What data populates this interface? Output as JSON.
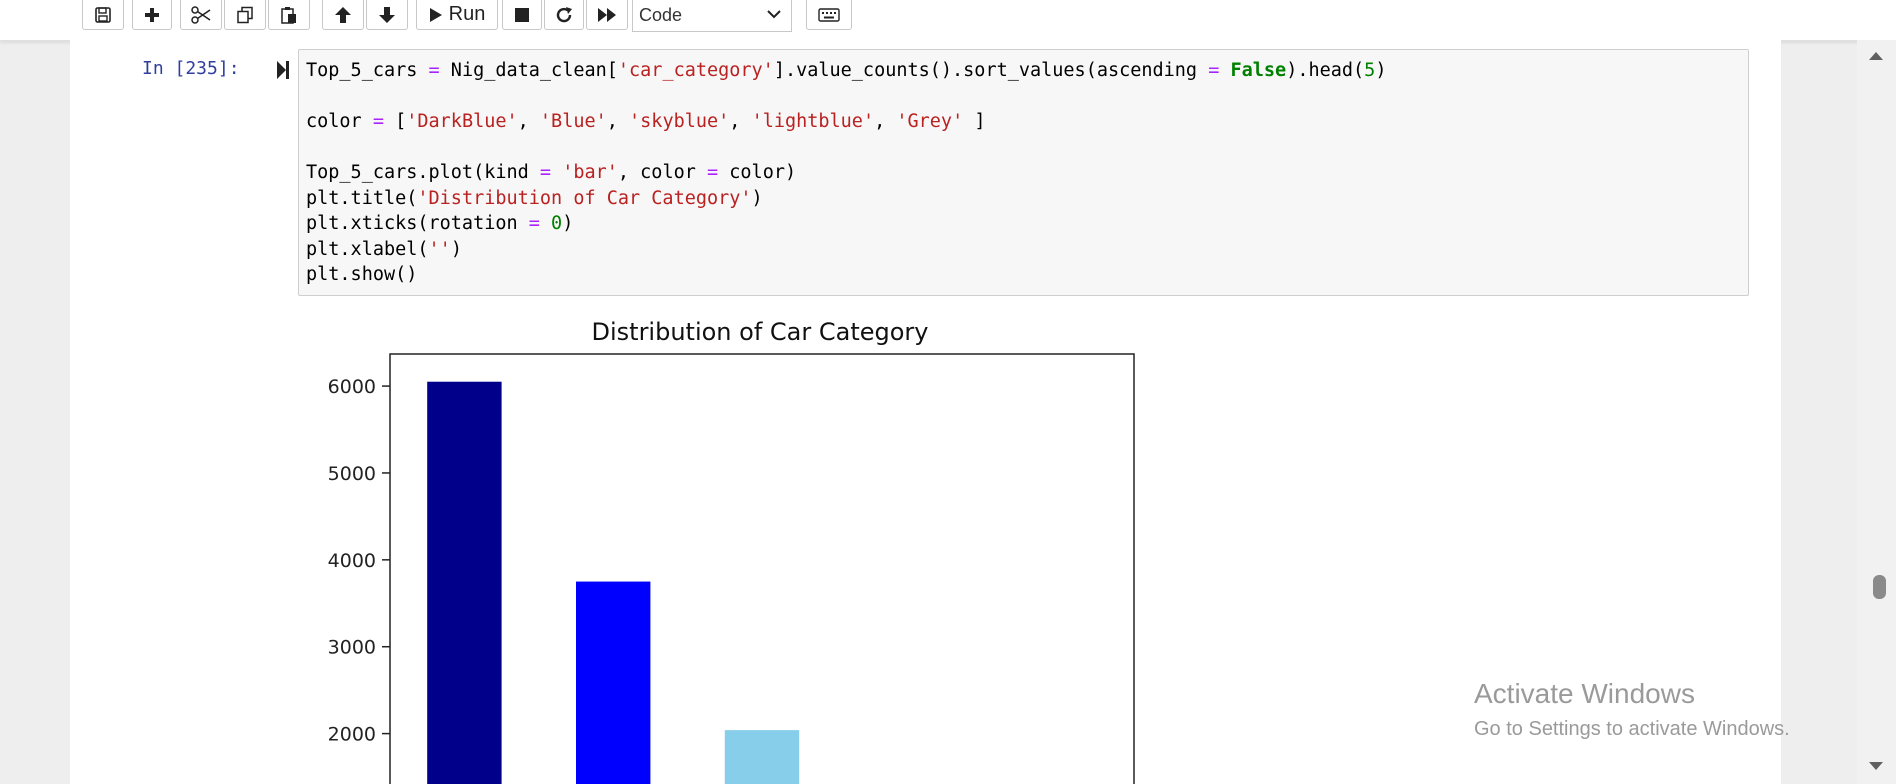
{
  "toolbar": {
    "run_label": "Run",
    "cell_type": "Code",
    "buttons": [
      "save-icon",
      "plus-icon",
      "scissors-icon",
      "copy-icon",
      "paste-icon",
      "arrow-up-icon",
      "arrow-down-icon",
      "run-icon",
      "stop-icon",
      "restart-icon",
      "fast-forward-icon",
      "keyboard-icon"
    ]
  },
  "cell": {
    "prompt": "In [235]:",
    "code_lines": [
      "Top_5_cars = Nig_data_clean['car_category'].value_counts().sort_values(ascending = False).head(5)",
      "",
      "color = ['DarkBlue', 'Blue', 'skyblue', 'lightblue', 'Grey' ]",
      "",
      "Top_5_cars.plot(kind = 'bar', color = color)",
      "plt.title('Distribution of Car Category')",
      "plt.xticks(rotation = 0)",
      "plt.xlabel('')",
      "plt.show()"
    ]
  },
  "chart_data": {
    "type": "bar",
    "title": "Distribution of Car Category",
    "xlabel": "",
    "ylabel": "",
    "yticks": [
      2000,
      3000,
      4000,
      5000,
      6000
    ],
    "visible_range": [
      1420,
      6300
    ],
    "values": [
      6050,
      3750,
      2040
    ],
    "colors": [
      "#00008B",
      "#0000FF",
      "#87CEEB"
    ],
    "legend": "none",
    "grid": false
  },
  "watermark": {
    "title": "Activate Windows",
    "subtitle": "Go to Settings to activate Windows."
  },
  "colors": {
    "prompt": "#303f9f",
    "string": "#ba2121",
    "operator": "#aa22ff",
    "keyword": "#008000"
  }
}
